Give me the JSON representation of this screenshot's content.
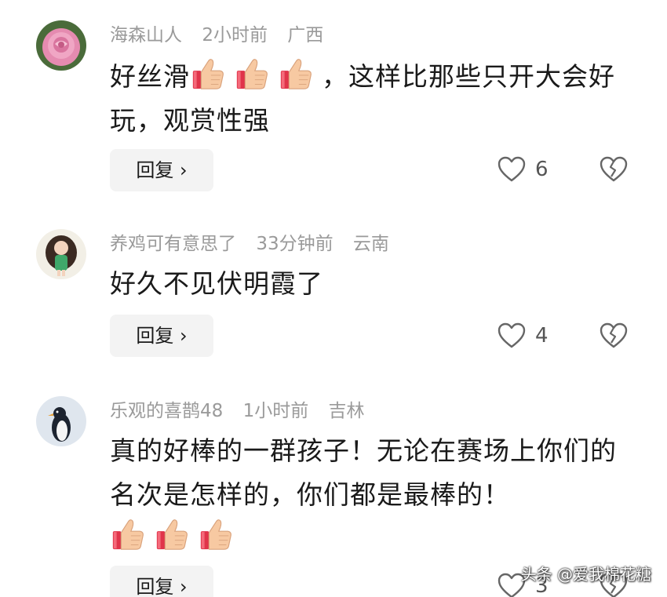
{
  "comments": [
    {
      "username": "海森山人",
      "time": "2小时前",
      "location": "广西",
      "text_before": "好丝滑",
      "text_after": "，这样比那些只开大会好玩，观赏性强",
      "reply_label": "回复 ›",
      "likes": "6"
    },
    {
      "username": "养鸡可有意思了",
      "time": "33分钟前",
      "location": "云南",
      "text": "好久不见伏明霞了",
      "reply_label": "回复 ›",
      "likes": "4"
    },
    {
      "username": "乐观的喜鹊48",
      "time": "1小时前",
      "location": "吉林",
      "text": "真的好棒的一群孩子！无论在赛场上你们的名次是怎样的，你们都是最棒的！",
      "reply_label": "回复 ›",
      "likes": "3"
    }
  ],
  "watermark": "头条 @爱我棉花糖",
  "icons": {
    "like": "heart-outline-icon",
    "dislike": "broken-heart-icon",
    "emoji": "thumbs-up-emoji"
  }
}
